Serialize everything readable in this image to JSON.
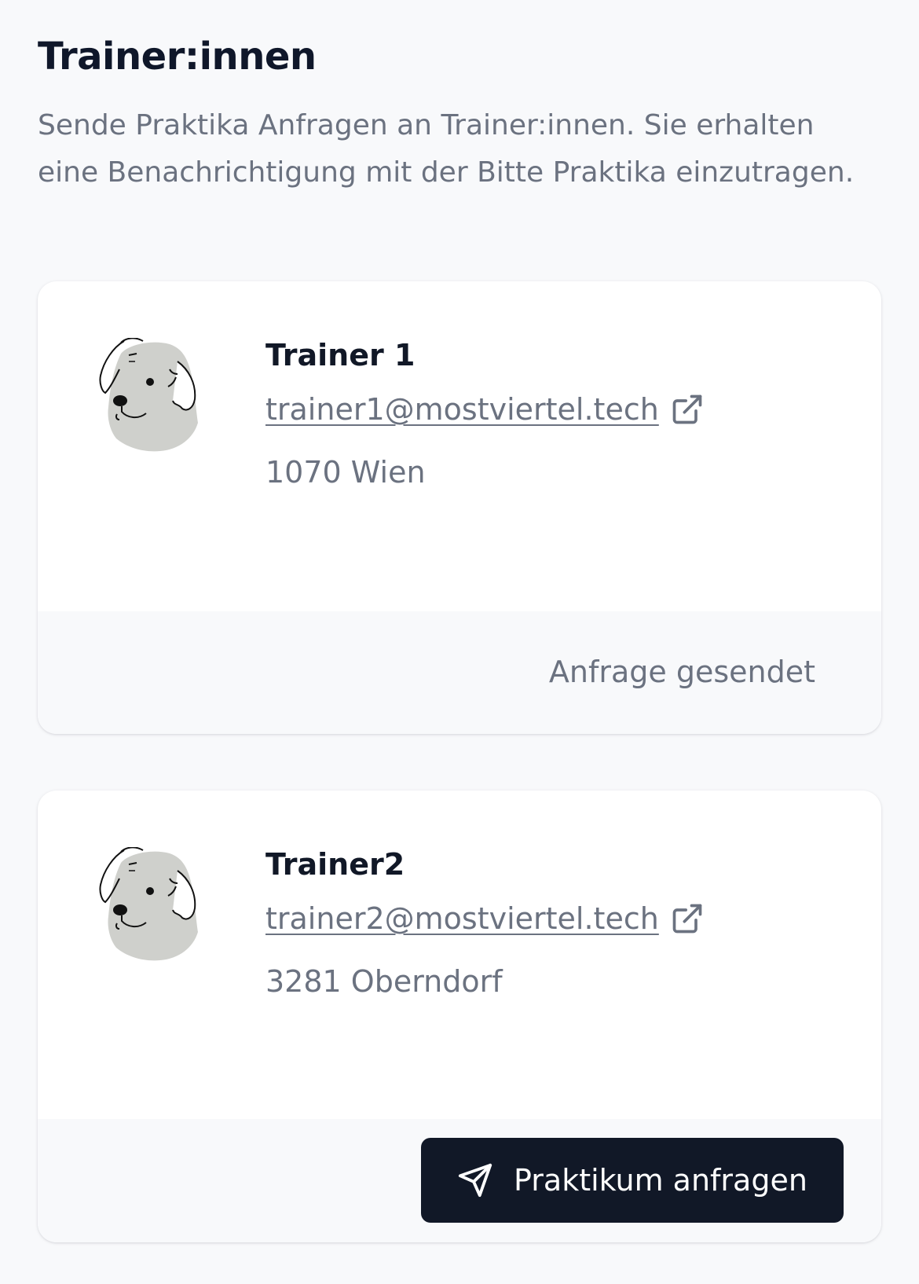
{
  "header": {
    "title": "Trainer:innen",
    "subtitle": "Sende Praktika Anfragen an Trainer:innen. Sie erhalten eine Benachrichtigung mit der Bitte Praktika einzutragen."
  },
  "trainers": [
    {
      "name": "Trainer 1",
      "email": "trainer1@mostviertel.tech",
      "location": "1070 Wien",
      "avatar_icon": "dog-avatar-icon",
      "status_text": "Anfrage gesendet"
    },
    {
      "name": "Trainer2",
      "email": "trainer2@mostviertel.tech",
      "location": "3281 Oberndorf",
      "avatar_icon": "dog-avatar-icon",
      "button_label": "Praktikum anfragen",
      "button_icon": "send-icon"
    }
  ],
  "colors": {
    "page_background": "#f8f9fb",
    "card_background": "#ffffff",
    "muted_text": "#6b7280",
    "primary_button": "#111827",
    "avatar_fill": "#cfd0cc"
  }
}
